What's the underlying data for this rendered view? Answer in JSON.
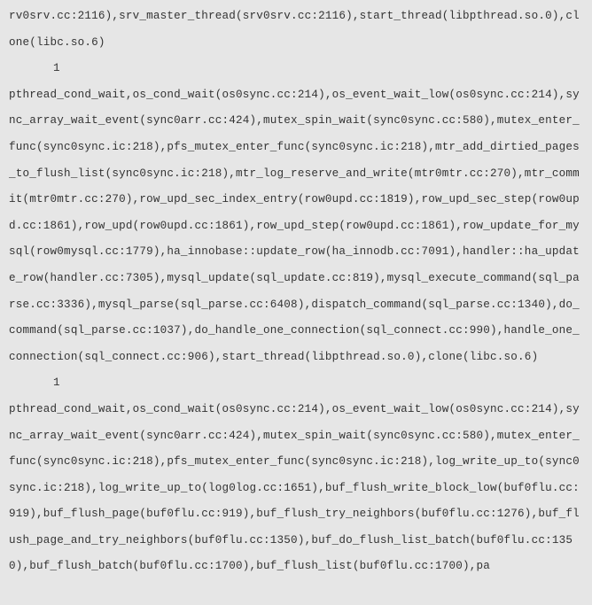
{
  "blocks": [
    {
      "trace": "rv0srv.cc:2116),srv_master_thread(srv0srv.cc:2116),start_thread(libpthread.so.0),clone(libc.so.6)",
      "count": "1"
    },
    {
      "trace": "pthread_cond_wait,os_cond_wait(os0sync.cc:214),os_event_wait_low(os0sync.cc:214),sync_array_wait_event(sync0arr.cc:424),mutex_spin_wait(sync0sync.cc:580),mutex_enter_func(sync0sync.ic:218),pfs_mutex_enter_func(sync0sync.ic:218),mtr_add_dirtied_pages_to_flush_list(sync0sync.ic:218),mtr_log_reserve_and_write(mtr0mtr.cc:270),mtr_commit(mtr0mtr.cc:270),row_upd_sec_index_entry(row0upd.cc:1819),row_upd_sec_step(row0upd.cc:1861),row_upd(row0upd.cc:1861),row_upd_step(row0upd.cc:1861),row_update_for_mysql(row0mysql.cc:1779),ha_innobase::update_row(ha_innodb.cc:7091),handler::ha_update_row(handler.cc:7305),mysql_update(sql_update.cc:819),mysql_execute_command(sql_parse.cc:3336),mysql_parse(sql_parse.cc:6408),dispatch_command(sql_parse.cc:1340),do_command(sql_parse.cc:1037),do_handle_one_connection(sql_connect.cc:990),handle_one_connection(sql_connect.cc:906),start_thread(libpthread.so.0),clone(libc.so.6)",
      "count": "1"
    },
    {
      "trace": "pthread_cond_wait,os_cond_wait(os0sync.cc:214),os_event_wait_low(os0sync.cc:214),sync_array_wait_event(sync0arr.cc:424),mutex_spin_wait(sync0sync.cc:580),mutex_enter_func(sync0sync.ic:218),pfs_mutex_enter_func(sync0sync.ic:218),log_write_up_to(sync0sync.ic:218),log_write_up_to(log0log.cc:1651),buf_flush_write_block_low(buf0flu.cc:919),buf_flush_page(buf0flu.cc:919),buf_flush_try_neighbors(buf0flu.cc:1276),buf_flush_page_and_try_neighbors(buf0flu.cc:1350),buf_do_flush_list_batch(buf0flu.cc:1350),buf_flush_batch(buf0flu.cc:1700),buf_flush_list(buf0flu.cc:1700),pa",
      "count": null
    }
  ]
}
